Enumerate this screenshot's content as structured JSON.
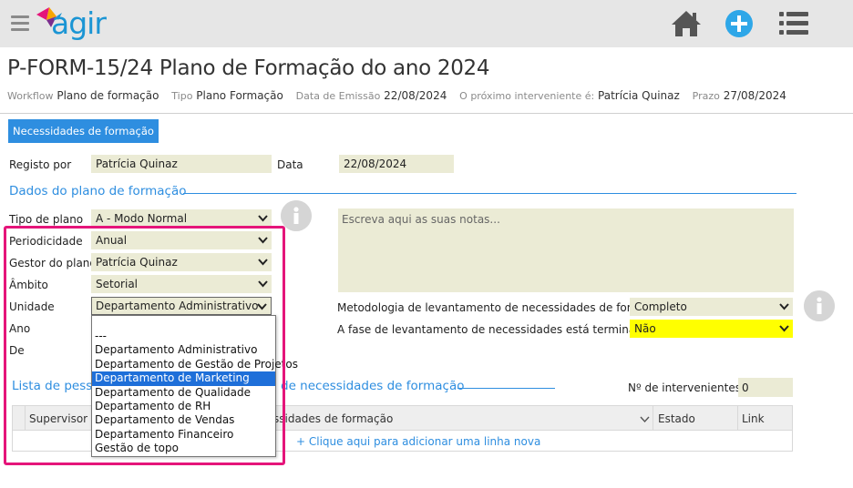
{
  "header": {
    "logo_text": "agir",
    "icons": [
      "menu-icon",
      "home-icon",
      "plus-circle-icon",
      "list-icon"
    ]
  },
  "title": "P-FORM-15/24 Plano de Formação do ano 2024",
  "meta": {
    "workflow_label": "Workflow",
    "workflow_value": "Plano de formação",
    "tipo_label": "Tipo",
    "tipo_value": "Plano Formação",
    "data_emissao_label": "Data de Emissão",
    "data_emissao_value": "22/08/2024",
    "proximo_label": "O próximo interveniente é:",
    "proximo_value": "Patrícia Quinaz",
    "prazo_label": "Prazo",
    "prazo_value": "27/08/2024"
  },
  "tab": {
    "label": "Necessidades de formação"
  },
  "registo": {
    "registo_label": "Registo por",
    "registo_value": "Patrícia Quinaz",
    "data_label": "Data",
    "data_value": "22/08/2024"
  },
  "section1": {
    "title": "Dados do plano de formação"
  },
  "form": {
    "tipo_plano_label": "Tipo de plano",
    "tipo_plano_value": "A - Modo Normal",
    "periodicidade_label": "Periodicidade",
    "periodicidade_value": "Anual",
    "gestor_label": "Gestor do plano",
    "gestor_value": "Patrícia Quinaz",
    "ambito_label": "Âmbito",
    "ambito_value": "Setorial",
    "unidade_label": "Unidade",
    "unidade_value": "Departamento Administrativo",
    "ano_label": "Ano",
    "de_label": "De"
  },
  "notes": {
    "placeholder": "Escreva aqui as suas notas..."
  },
  "metodologia": {
    "label": "Metodologia de levantamento de necessidades de formação",
    "value": "Completo"
  },
  "fase": {
    "label": "A fase de levantamento de necessidades está terminada?",
    "value": "Não"
  },
  "section2": {
    "title_left": "Lista de pess",
    "title_right": "de necessidades de formação",
    "count_label": "Nº de intervenientes",
    "count_value": "0"
  },
  "table": {
    "col_supervisor": "Supervisor",
    "col_necessidades": "ssidades de formação",
    "col_estado": "Estado",
    "col_link": "Link",
    "add_row": "+ Clique aqui para adicionar uma linha nova"
  },
  "dropdown": {
    "options": [
      "---",
      "Departamento Administrativo",
      "Departamento de Gestão de Projetos",
      "Departamento de Marketing",
      "Departamento de Qualidade",
      "Departamento de RH",
      "Departamento de Vendas",
      "Departamento Financeiro",
      "Gestão de topo"
    ],
    "highlighted": "Departamento de Marketing"
  },
  "colors": {
    "accent": "#2e8ee0",
    "field_bg": "#ebebd5",
    "highlight_border": "#e5157a",
    "warning_field": "#ffff00"
  }
}
